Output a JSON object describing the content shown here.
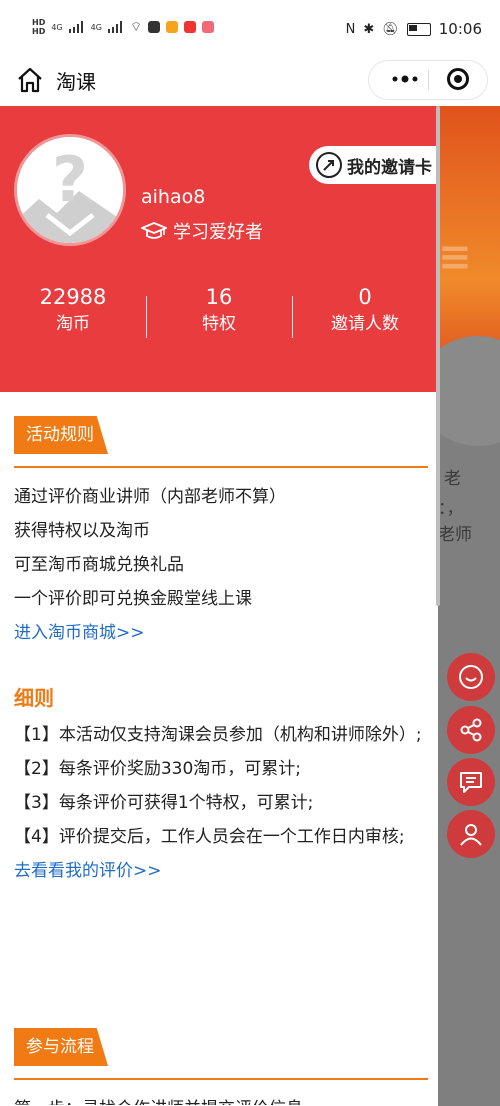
{
  "statusbar": {
    "time": "10:06",
    "hd1": "HD",
    "hd2": "HD",
    "net1": "4G",
    "net2": "4G"
  },
  "navbar": {
    "title": "淘课"
  },
  "profile": {
    "username": "aihao8",
    "role": "学习爱好者",
    "invite_card": "我的邀请卡",
    "stats": [
      {
        "value": "22988",
        "label": "淘币"
      },
      {
        "value": "16",
        "label": "特权"
      },
      {
        "value": "0",
        "label": "邀请人数"
      }
    ]
  },
  "rules": {
    "tag": "活动规则",
    "lines": [
      "通过评价商业讲师（内部老师不算）",
      "获得特权以及淘币",
      "可至淘币商城兑换礼品",
      "一个评价即可兑换金殿堂线上课"
    ],
    "link": "进入淘币商城>>"
  },
  "details": {
    "title": "细则",
    "items": [
      "【1】本活动仅支持淘课会员参加（机构和讲师除外）;",
      "【2】每条评价奖励330淘币，可累计;",
      "【3】每条评价可获得1个特权，可累计;",
      "【4】评价提交后，工作人员会在一个工作日内审核;"
    ],
    "link": "去看看我的评价>>"
  },
  "process": {
    "tag": "参与流程",
    "first_line": "第一步：寻找合作讲师并提交评价信息"
  },
  "background_fragments": [
    "老",
    "：，",
    "老师"
  ],
  "colors": {
    "header_red": "#e83c3f",
    "accent_orange": "#f07a14",
    "link_blue": "#1f6cc7",
    "fab_red": "#cf3b3d"
  },
  "icons": [
    "home-icon",
    "more-dots-icon",
    "close-target-icon",
    "graduation-cap-icon",
    "share-arrow-icon",
    "chat-bubble-icon",
    "share-nodes-icon",
    "message-icon",
    "user-icon"
  ]
}
